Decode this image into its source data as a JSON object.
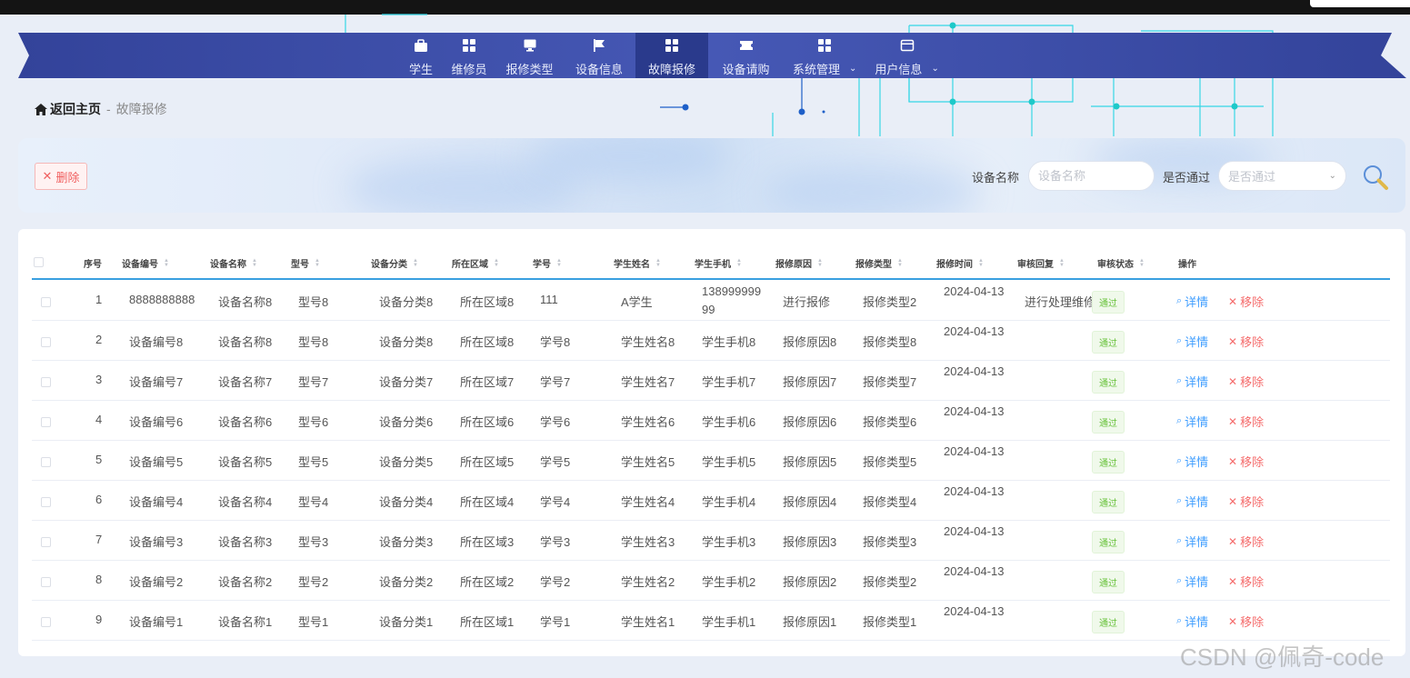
{
  "nav": {
    "items": [
      {
        "label": "学生",
        "icon": "briefcase-icon"
      },
      {
        "label": "维修员",
        "icon": "grid-icon"
      },
      {
        "label": "报修类型",
        "icon": "monitor-icon"
      },
      {
        "label": "设备信息",
        "icon": "flag-icon"
      },
      {
        "label": "故障报修",
        "icon": "grid-icon",
        "active": true
      },
      {
        "label": "设备请购",
        "icon": "ticket-icon"
      },
      {
        "label": "系统管理",
        "icon": "grid-icon",
        "dropdown": true
      },
      {
        "label": "用户信息",
        "icon": "card-icon",
        "dropdown": true
      }
    ]
  },
  "breadcrumb": {
    "home": "返回主页",
    "sep": "-",
    "current": "故障报修"
  },
  "toolbar": {
    "delete_label": "删除"
  },
  "search": {
    "name_label": "设备名称",
    "name_placeholder": "设备名称",
    "approved_label": "是否通过",
    "approved_placeholder": "是否通过"
  },
  "table": {
    "headers": [
      "序号",
      "设备编号",
      "设备名称",
      "型号",
      "设备分类",
      "所在区域",
      "学号",
      "学生姓名",
      "学生手机",
      "报修原因",
      "报修类型",
      "报修时间",
      "审核回复",
      "审核状态",
      "操作"
    ],
    "detail_label": "详情",
    "remove_label": "移除",
    "rows": [
      {
        "no": "1",
        "code": "8888888888",
        "name": "设备名称8",
        "model": "型号8",
        "category": "设备分类8",
        "area": "所在区域8",
        "sid": "111",
        "sname": "A学生",
        "phone": "13899999999",
        "reason": "进行报修",
        "type": "报修类型2",
        "time": "2024-04-13",
        "reply": "进行处理维修",
        "status": "通过"
      },
      {
        "no": "2",
        "code": "设备编号8",
        "name": "设备名称8",
        "model": "型号8",
        "category": "设备分类8",
        "area": "所在区域8",
        "sid": "学号8",
        "sname": "学生姓名8",
        "phone": "学生手机8",
        "reason": "报修原因8",
        "type": "报修类型8",
        "time": "2024-04-13",
        "reply": "",
        "status": "通过"
      },
      {
        "no": "3",
        "code": "设备编号7",
        "name": "设备名称7",
        "model": "型号7",
        "category": "设备分类7",
        "area": "所在区域7",
        "sid": "学号7",
        "sname": "学生姓名7",
        "phone": "学生手机7",
        "reason": "报修原因7",
        "type": "报修类型7",
        "time": "2024-04-13",
        "reply": "",
        "status": "通过"
      },
      {
        "no": "4",
        "code": "设备编号6",
        "name": "设备名称6",
        "model": "型号6",
        "category": "设备分类6",
        "area": "所在区域6",
        "sid": "学号6",
        "sname": "学生姓名6",
        "phone": "学生手机6",
        "reason": "报修原因6",
        "type": "报修类型6",
        "time": "2024-04-13",
        "reply": "",
        "status": "通过"
      },
      {
        "no": "5",
        "code": "设备编号5",
        "name": "设备名称5",
        "model": "型号5",
        "category": "设备分类5",
        "area": "所在区域5",
        "sid": "学号5",
        "sname": "学生姓名5",
        "phone": "学生手机5",
        "reason": "报修原因5",
        "type": "报修类型5",
        "time": "2024-04-13",
        "reply": "",
        "status": "通过"
      },
      {
        "no": "6",
        "code": "设备编号4",
        "name": "设备名称4",
        "model": "型号4",
        "category": "设备分类4",
        "area": "所在区域4",
        "sid": "学号4",
        "sname": "学生姓名4",
        "phone": "学生手机4",
        "reason": "报修原因4",
        "type": "报修类型4",
        "time": "2024-04-13",
        "reply": "",
        "status": "通过"
      },
      {
        "no": "7",
        "code": "设备编号3",
        "name": "设备名称3",
        "model": "型号3",
        "category": "设备分类3",
        "area": "所在区域3",
        "sid": "学号3",
        "sname": "学生姓名3",
        "phone": "学生手机3",
        "reason": "报修原因3",
        "type": "报修类型3",
        "time": "2024-04-13",
        "reply": "",
        "status": "通过"
      },
      {
        "no": "8",
        "code": "设备编号2",
        "name": "设备名称2",
        "model": "型号2",
        "category": "设备分类2",
        "area": "所在区域2",
        "sid": "学号2",
        "sname": "学生姓名2",
        "phone": "学生手机2",
        "reason": "报修原因2",
        "type": "报修类型2",
        "time": "2024-04-13",
        "reply": "",
        "status": "通过"
      },
      {
        "no": "9",
        "code": "设备编号1",
        "name": "设备名称1",
        "model": "型号1",
        "category": "设备分类1",
        "area": "所在区域1",
        "sid": "学号1",
        "sname": "学生姓名1",
        "phone": "学生手机1",
        "reason": "报修原因1",
        "type": "报修类型1",
        "time": "2024-04-13",
        "reply": "",
        "status": "通过"
      }
    ]
  },
  "watermark": "CSDN @佩奇-code",
  "colors": {
    "nav_bg": "#3a4ba3",
    "nav_active": "#2a3a8c",
    "accent_line": "#3aa0e0",
    "success": "#67c23a",
    "danger": "#f56c6c",
    "link": "#409eff"
  }
}
